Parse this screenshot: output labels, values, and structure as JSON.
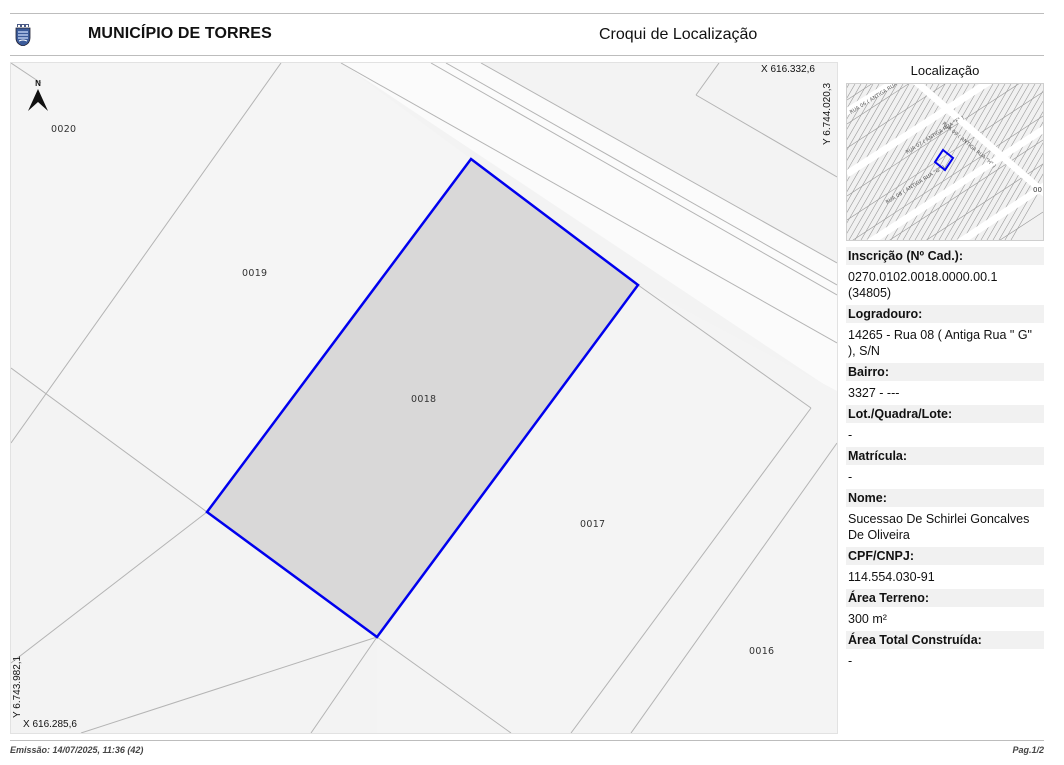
{
  "header": {
    "municipality": "MUNICÍPIO DE TORRES",
    "document_title": "Croqui de Localização",
    "logo_icon": "municipal-coat-of-arms-icon"
  },
  "map": {
    "north_label": "N",
    "coord_top_x": "X 616.332,6",
    "coord_top_y": "Y 6.744.020,3",
    "coord_bottom_x": "X 616.285,6",
    "coord_bottom_y": "Y 6.743.982,1",
    "parcel_labels": [
      "0020",
      "0019",
      "0018",
      "0017",
      "0016"
    ],
    "highlight_color": "#0000ee",
    "highlight_fill": "#d9d8d8"
  },
  "location": {
    "title": "Localização",
    "street_labels": [
      "RUA 06 ( ANTIGA RUA \"E\" )",
      "RUA 07 ( ANTIGA RUA \"F\" )",
      "RUA 08 ( ANTIGA RUA \"G\" )",
      "RUA 09 ( ANTIGA RUA \"H\" )"
    ],
    "side_label": "00"
  },
  "info": {
    "inscricao_label": "Inscrição (Nº Cad.):",
    "inscricao_value": "0270.0102.0018.0000.00.1 (34805)",
    "logradouro_label": "Logradouro:",
    "logradouro_value": "14265 - Rua 08 ( Antiga Rua \" G\" ), S/N",
    "bairro_label": "Bairro:",
    "bairro_value": "3327 - ---",
    "lote_label": "Lot./Quadra/Lote:",
    "lote_value": "-",
    "matricula_label": "Matrícula:",
    "matricula_value": "-",
    "nome_label": "Nome:",
    "nome_value": "Sucessao De Schirlei Goncalves De Oliveira",
    "cpf_label": "CPF/CNPJ:",
    "cpf_value": "114.554.030-91",
    "area_terreno_label": "Área Terreno:",
    "area_terreno_value": "300 m²",
    "area_construida_label": "Área Total Construída:",
    "area_construida_value": "-"
  },
  "footer": {
    "emissao": "Emissão: 14/07/2025, 11:36 (42)",
    "page": "Pag.1/2"
  }
}
